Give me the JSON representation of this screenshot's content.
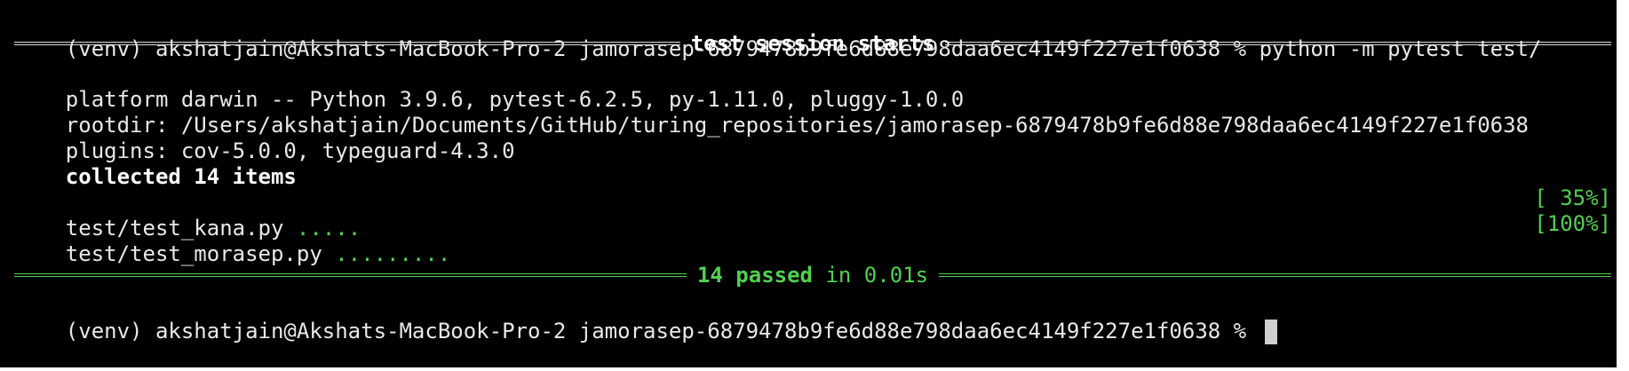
{
  "terminal": {
    "prompt_line": "(venv) akshatjain@Akshats-MacBook-Pro-2 jamorasep-6879478b9fe6d88e798daa6ec4149f227e1f0638 % python -m pytest test/",
    "session_title": "test session starts",
    "platform_line": "platform darwin -- Python 3.9.6, pytest-6.2.5, py-1.11.0, pluggy-1.0.0",
    "rootdir_line": "rootdir: /Users/akshatjain/Documents/GitHub/turing_repositories/jamorasep-6879478b9fe6d88e798daa6ec4149f227e1f0638",
    "plugins_line": "plugins: cov-5.0.0, typeguard-4.3.0",
    "collected_line": "collected 14 items",
    "results": [
      {
        "file": "test/test_kana.py ",
        "dots": ".....",
        "percent": "[ 35%]"
      },
      {
        "file": "test/test_morasep.py ",
        "dots": ".........",
        "percent": "[100%]"
      }
    ],
    "summary": {
      "passed": "14 passed",
      "duration": " in 0.01s"
    },
    "final_prompt": "(venv) akshatjain@Akshats-MacBook-Pro-2 jamorasep-6879478b9fe6d88e798daa6ec4149f227e1f0638 % ",
    "colors": {
      "background": "#000000",
      "text": "#e8e8e8",
      "success": "#4fd14f"
    }
  }
}
